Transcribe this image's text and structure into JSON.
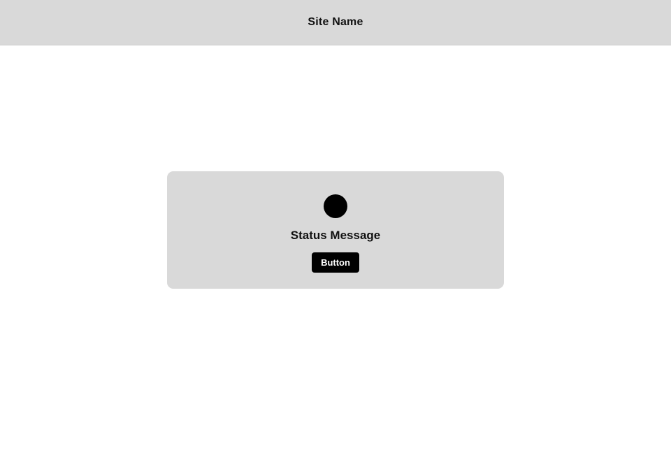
{
  "header": {
    "site_name": "Site Name",
    "background_color": "#d9d9d9"
  },
  "status_card": {
    "icon": "filled-circle-icon",
    "icon_color": "#000000",
    "message": "Status Message",
    "button_label": "Button",
    "button_color": "#000000",
    "background_color": "#d9d9d9"
  }
}
